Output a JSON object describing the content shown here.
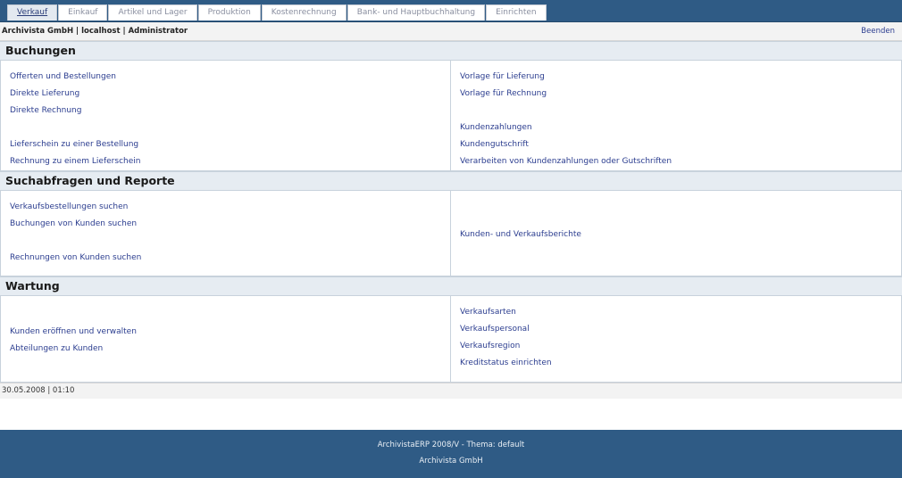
{
  "tabs": [
    "Verkauf",
    "Einkauf",
    "Artikel und Lager",
    "Produktion",
    "Kostenrechnung",
    "Bank- und Hauptbuchhaltung",
    "Einrichten"
  ],
  "info": {
    "company_user": "Archivista GmbH | localhost | Administrator",
    "logout": "Beenden"
  },
  "sections": {
    "buchungen": {
      "title": "Buchungen",
      "left": [
        "Offerten und Bestellungen",
        "Direkte Lieferung",
        "Direkte Rechnung",
        "Lieferschein zu einer Bestellung",
        "Rechnung zu einem Lieferschein"
      ],
      "right": [
        "Vorlage für Lieferung",
        "Vorlage für Rechnung",
        "Kundenzahlungen",
        "Kundengutschrift",
        "Verarbeiten von Kundenzahlungen oder Gutschriften"
      ]
    },
    "suche": {
      "title": "Suchabfragen und Reporte",
      "left": [
        "Verkaufsbestellungen suchen",
        "Buchungen von Kunden suchen",
        "Rechnungen von Kunden suchen"
      ],
      "right": [
        "Kunden- und Verkaufsberichte"
      ]
    },
    "wartung": {
      "title": "Wartung",
      "left": [
        "Kunden eröffnen und verwalten",
        "Abteilungen zu Kunden"
      ],
      "right": [
        "Verkaufsarten",
        "Verkaufspersonal",
        "Verkaufsregion",
        "Kreditstatus einrichten"
      ]
    }
  },
  "status": {
    "datetime": "30.05.2008 | 01:10"
  },
  "footer": {
    "line1": "ArchivistaERP 2008/V - Thema: default",
    "line2": "Archivista GmbH"
  }
}
